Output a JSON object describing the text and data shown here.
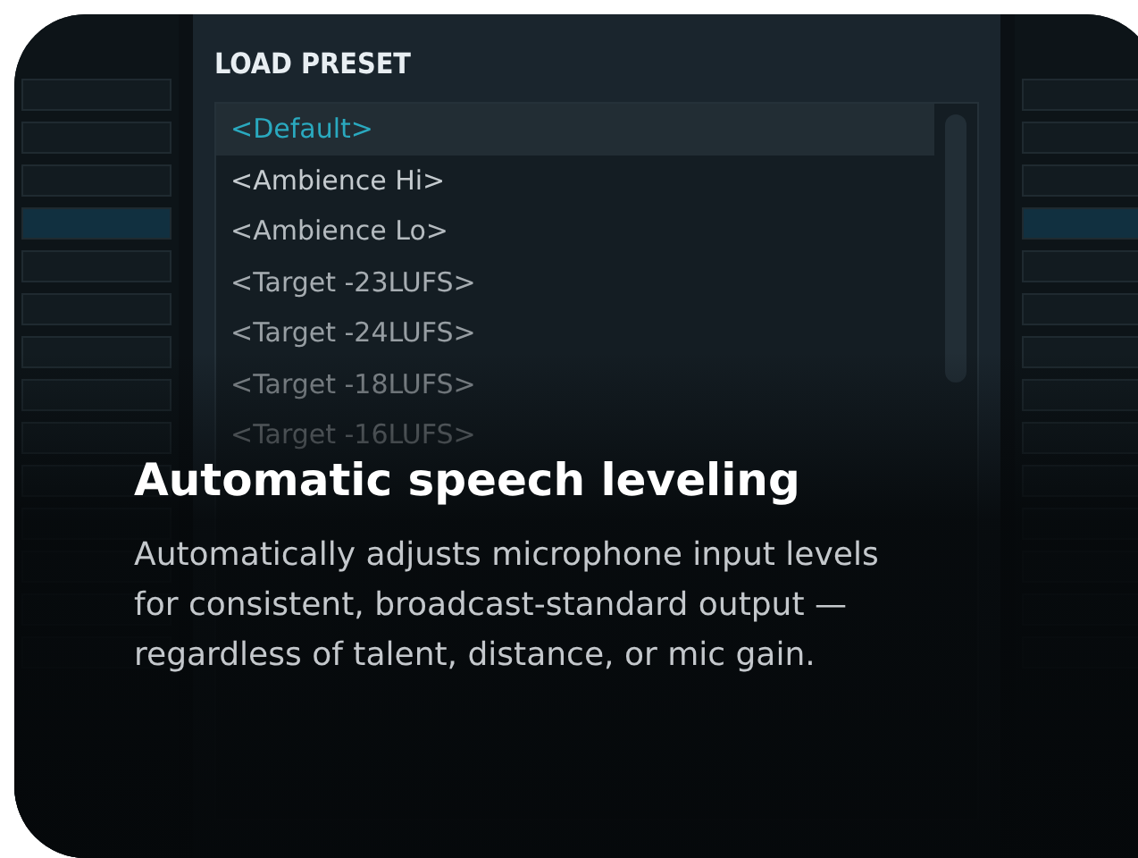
{
  "dialog": {
    "title": "LOAD PRESET",
    "presets": [
      {
        "label": "<Default>",
        "selected": true
      },
      {
        "label": "<Ambience Hi>",
        "selected": false
      },
      {
        "label": "<Ambience Lo>",
        "selected": false
      },
      {
        "label": "<Target -23LUFS>",
        "selected": false
      },
      {
        "label": "<Target -24LUFS>",
        "selected": false
      },
      {
        "label": "<Target -18LUFS>",
        "selected": false
      },
      {
        "label": "<Target -16LUFS>",
        "selected": false
      }
    ]
  },
  "feature": {
    "title": "Automatic speech leveling",
    "description": "Automatically adjusts microphone input levels for consistent, broadcast-standard output — regardless of talent, distance, or mic gain."
  }
}
